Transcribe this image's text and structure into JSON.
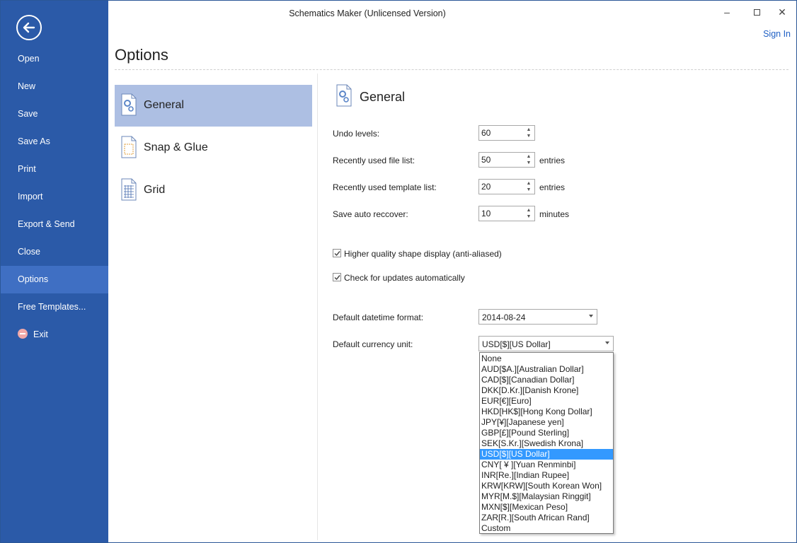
{
  "window": {
    "title": "Schematics Maker (Unlicensed Version)",
    "sign_in": "Sign In"
  },
  "sidebar": {
    "items": [
      {
        "label": "Open"
      },
      {
        "label": "New"
      },
      {
        "label": "Save"
      },
      {
        "label": "Save As"
      },
      {
        "label": "Print"
      },
      {
        "label": "Import"
      },
      {
        "label": "Export & Send"
      },
      {
        "label": "Close"
      },
      {
        "label": "Options",
        "active": true
      },
      {
        "label": "Free Templates..."
      },
      {
        "label": "Exit"
      }
    ]
  },
  "page": {
    "title": "Options"
  },
  "categories": [
    {
      "label": "General",
      "icon": "gear-document-icon",
      "active": true
    },
    {
      "label": "Snap & Glue",
      "icon": "snap-glue-icon"
    },
    {
      "label": "Grid",
      "icon": "grid-icon"
    }
  ],
  "general": {
    "title": "General",
    "undo": {
      "label": "Undo levels:",
      "value": "60"
    },
    "recent_files": {
      "label": "Recently used file list:",
      "value": "50",
      "unit": "entries"
    },
    "recent_templates": {
      "label": "Recently used template list:",
      "value": "20",
      "unit": "entries"
    },
    "auto_recover": {
      "label": "Save auto reccover:",
      "value": "10",
      "unit": "minutes"
    },
    "antialias": {
      "label": "Higher quality shape display (anti-aliased)",
      "checked": true
    },
    "updates": {
      "label": "Check for updates automatically",
      "checked": true
    },
    "datetime": {
      "label": "Default datetime format:",
      "value": "2014-08-24"
    },
    "currency": {
      "label": "Default currency unit:",
      "value": "USD[$][US Dollar]",
      "options": [
        "None",
        "AUD[$A.][Australian Dollar]",
        "CAD[$][Canadian Dollar]",
        "DKK[D.Kr.][Danish Krone]",
        "EUR[€][Euro]",
        "HKD[HK$][Hong Kong Dollar]",
        "JPY[¥][Japanese yen]",
        "GBP[£][Pound Sterling]",
        "SEK[S.Kr.][Swedish Krona]",
        "USD[$][US Dollar]",
        "CNY[ ¥ ][Yuan Renminbi]",
        "INR[Re.][Indian Rupee]",
        "KRW[KRW][South Korean Won]",
        "MYR[M.$][Malaysian Ringgit]",
        "MXN[$][Mexican Peso]",
        "ZAR[R.][South African Rand]",
        "Custom"
      ],
      "selected_index": 9
    }
  },
  "colors": {
    "sidebar": "#2b5aa8",
    "sidebar_active": "#3f6fc3",
    "category_active": "#adbfe3",
    "selection": "#3399ff",
    "link": "#1e5fc4"
  }
}
